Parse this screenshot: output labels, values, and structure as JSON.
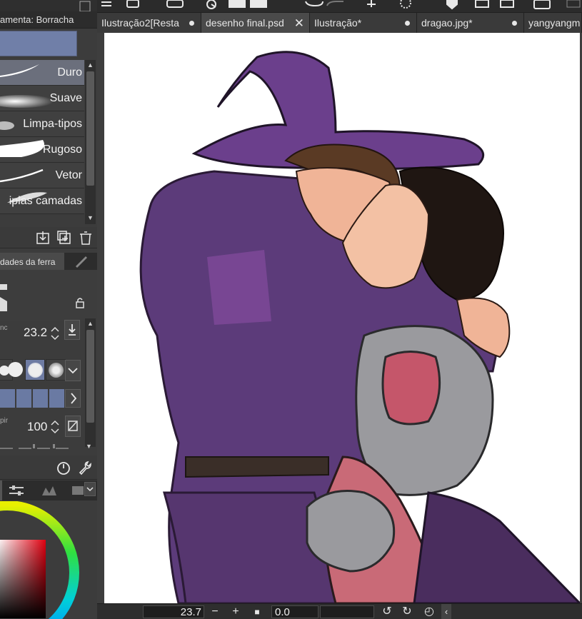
{
  "panel": {
    "title": "amenta: Borracha"
  },
  "tabs": [
    {
      "label": "Ilustração2[Resta",
      "modified": true
    },
    {
      "label": "desenho final.psd",
      "closable": true
    },
    {
      "label": "Ilustração*",
      "modified": true
    },
    {
      "label": "dragao.jpg*",
      "modified": true
    },
    {
      "label": "yangyangm"
    }
  ],
  "brushes": [
    {
      "label": "Duro",
      "selected": true
    },
    {
      "label": "Suave"
    },
    {
      "label": "Limpa-tipos"
    },
    {
      "label": "Rugoso"
    },
    {
      "label": "Vetor"
    },
    {
      "label": "iplas camadas"
    }
  ],
  "tool_properties": {
    "title": "dades da ferra",
    "size_label": "nc",
    "size_value": "23.2",
    "opacity_label": "pir",
    "opacity_value": "100"
  },
  "status": {
    "zoom": "23.7",
    "rotation": "0.0"
  },
  "icons": {
    "toolbar": [
      "new-layer-icon",
      "layer-icon",
      "undo-icon",
      "redo-icon",
      "move-icon",
      "gear-icon",
      "heart-icon",
      "transform-icon",
      "transform-icon-2",
      "camera-icon",
      "menu-icon"
    ],
    "panel": [
      "download-icon",
      "add-icon",
      "trash-icon",
      "lock-icon",
      "settings-icon",
      "wrench-icon"
    ]
  },
  "colors": {
    "accent": "#6f7ca3",
    "panel_bg": "#3c3c3c",
    "canvas_bg": "#ffffff"
  }
}
